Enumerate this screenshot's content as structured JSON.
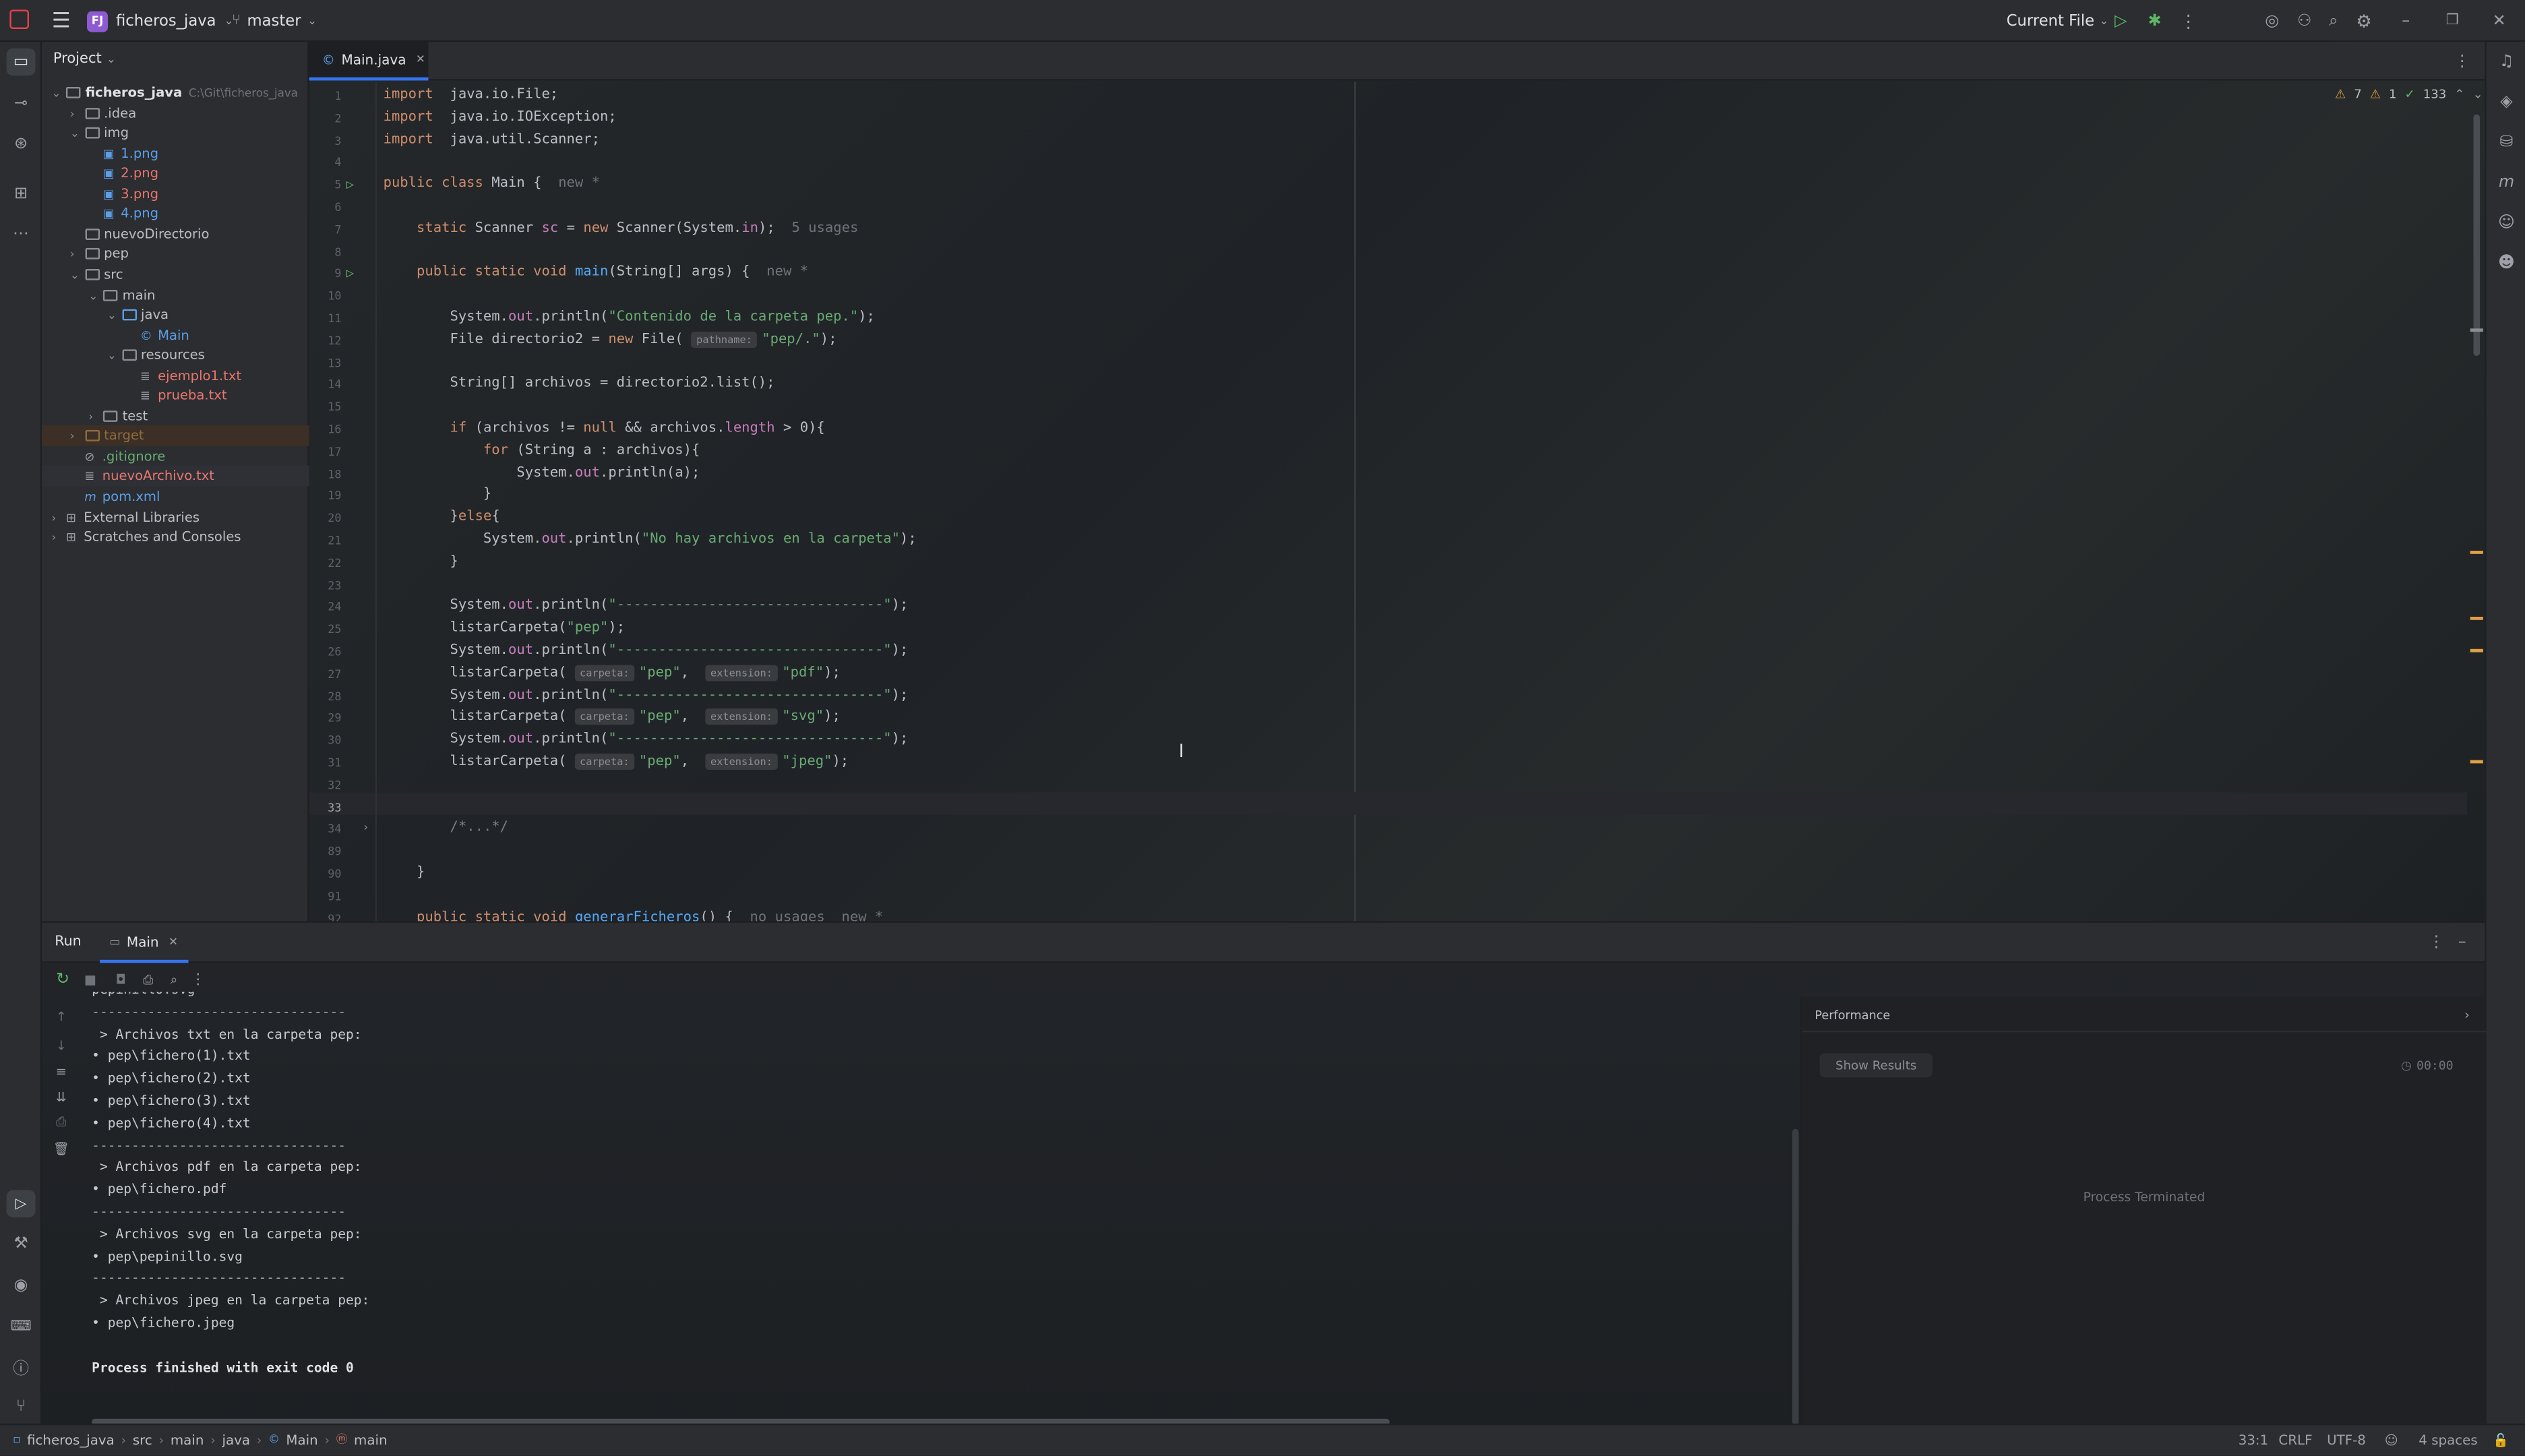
{
  "titlebar": {
    "project_badge": "FJ",
    "project_name": "ficheros_java",
    "branch": "master",
    "run_config": "Current File"
  },
  "project_panel": {
    "title": "Project",
    "tree": [
      {
        "label": "ficheros_java",
        "extra": "C:\\Git\\ficheros_java",
        "depth": 0,
        "chev": "v",
        "kind": "folder",
        "color": "#dfe1e5",
        "bold": true
      },
      {
        "label": ".idea",
        "depth": 1,
        "chev": ">",
        "kind": "folder",
        "color": "#bcbec4"
      },
      {
        "label": "img",
        "depth": 1,
        "chev": "v",
        "kind": "folder",
        "color": "#bcbec4"
      },
      {
        "label": "1.png",
        "depth": 2,
        "chev": "",
        "kind": "image",
        "color": "#5c9fe8"
      },
      {
        "label": "2.png",
        "depth": 2,
        "chev": "",
        "kind": "image",
        "color": "#e8766e"
      },
      {
        "label": "3.png",
        "depth": 2,
        "chev": "",
        "kind": "image",
        "color": "#e8766e"
      },
      {
        "label": "4.png",
        "depth": 2,
        "chev": "",
        "kind": "image",
        "color": "#5c9fe8"
      },
      {
        "label": "nuevoDirectorio",
        "depth": 1,
        "chev": "",
        "kind": "folder",
        "color": "#bcbec4"
      },
      {
        "label": "pep",
        "depth": 1,
        "chev": ">",
        "kind": "folder",
        "color": "#bcbec4"
      },
      {
        "label": "src",
        "depth": 1,
        "chev": "v",
        "kind": "folder",
        "color": "#bcbec4"
      },
      {
        "label": "main",
        "depth": 2,
        "chev": "v",
        "kind": "folder",
        "color": "#bcbec4"
      },
      {
        "label": "java",
        "depth": 3,
        "chev": "v",
        "kind": "folder-src",
        "color": "#bcbec4"
      },
      {
        "label": "Main",
        "depth": 4,
        "chev": "",
        "kind": "class",
        "color": "#5c9fe8"
      },
      {
        "label": "resources",
        "depth": 3,
        "chev": "v",
        "kind": "folder-res",
        "color": "#bcbec4"
      },
      {
        "label": "ejemplo1.txt",
        "depth": 4,
        "chev": "",
        "kind": "text",
        "color": "#e8766e"
      },
      {
        "label": "prueba.txt",
        "depth": 4,
        "chev": "",
        "kind": "text",
        "color": "#e8766e"
      },
      {
        "label": "test",
        "depth": 2,
        "chev": ">",
        "kind": "folder",
        "color": "#bcbec4"
      },
      {
        "label": "target",
        "depth": 1,
        "chev": ">",
        "kind": "folder",
        "color": "#8f6c3f",
        "excluded": true
      },
      {
        "label": ".gitignore",
        "depth": 1,
        "chev": "",
        "kind": "ignore",
        "color": "#6aab73"
      },
      {
        "label": "nuevoArchivo.txt",
        "depth": 1,
        "chev": "",
        "kind": "text",
        "color": "#e8766e",
        "selected": true
      },
      {
        "label": "pom.xml",
        "depth": 1,
        "chev": "",
        "kind": "maven",
        "color": "#5c9fe8"
      },
      {
        "label": "External Libraries",
        "depth": 0,
        "chev": ">",
        "kind": "lib",
        "color": "#bcbec4"
      },
      {
        "label": "Scratches and Consoles",
        "depth": 0,
        "chev": ">",
        "kind": "scratch",
        "color": "#bcbec4"
      }
    ]
  },
  "editor": {
    "tab_label": "Main.java",
    "inspections": {
      "warnings": "7",
      "weak": "1",
      "ok": "133"
    },
    "code_lines": [
      {
        "n": "1",
        "seg": [
          [
            "kw",
            "import"
          ],
          [
            "",
            "  java.io.File;"
          ]
        ]
      },
      {
        "n": "2",
        "seg": [
          [
            "kw",
            "import"
          ],
          [
            "",
            "  java.io.IOException;"
          ]
        ]
      },
      {
        "n": "3",
        "seg": [
          [
            "kw",
            "import"
          ],
          [
            "",
            "  java.util.Scanner;"
          ]
        ]
      },
      {
        "n": "4",
        "seg": []
      },
      {
        "n": "5",
        "seg": [
          [
            "kw",
            "public class"
          ],
          [
            "",
            " Main {  "
          ],
          [
            "dim",
            "new *"
          ]
        ],
        "run": true
      },
      {
        "n": "6",
        "seg": []
      },
      {
        "n": "7",
        "seg": [
          [
            "",
            "    "
          ],
          [
            "kw",
            "static"
          ],
          [
            "",
            " Scanner "
          ],
          [
            "fld",
            "sc"
          ],
          [
            "",
            " = "
          ],
          [
            "kw",
            "new"
          ],
          [
            "",
            " Scanner(System."
          ],
          [
            "fld",
            "in"
          ],
          [
            "",
            ");  "
          ],
          [
            "dim",
            "5 usages"
          ]
        ]
      },
      {
        "n": "8",
        "seg": []
      },
      {
        "n": "9",
        "seg": [
          [
            "",
            "    "
          ],
          [
            "kw",
            "public static void"
          ],
          [
            "",
            " "
          ],
          [
            "mth",
            "main"
          ],
          [
            "",
            "(String[] args) {  "
          ],
          [
            "dim",
            "new *"
          ]
        ],
        "run": true
      },
      {
        "n": "10",
        "seg": []
      },
      {
        "n": "11",
        "seg": [
          [
            "",
            "        System."
          ],
          [
            "fld",
            "out"
          ],
          [
            "",
            ".println("
          ],
          [
            "str",
            "\"Contenido de la carpeta pep.\""
          ],
          [
            "",
            ");"
          ]
        ]
      },
      {
        "n": "12",
        "seg": [
          [
            "",
            "        File directorio2 = "
          ],
          [
            "kw",
            "new"
          ],
          [
            "",
            " File( "
          ],
          [
            "hint",
            "pathname:"
          ],
          [
            "str",
            "\"pep/.\""
          ],
          [
            "",
            ");"
          ]
        ]
      },
      {
        "n": "13",
        "seg": []
      },
      {
        "n": "14",
        "seg": [
          [
            "",
            "        String[] archivos = directorio2.list();"
          ]
        ]
      },
      {
        "n": "15",
        "seg": []
      },
      {
        "n": "16",
        "seg": [
          [
            "",
            "        "
          ],
          [
            "kw",
            "if"
          ],
          [
            "",
            " (archivos != "
          ],
          [
            "kw",
            "null"
          ],
          [
            "",
            " && archivos."
          ],
          [
            "fld",
            "length"
          ],
          [
            "",
            " > 0){"
          ]
        ]
      },
      {
        "n": "17",
        "seg": [
          [
            "",
            "            "
          ],
          [
            "kw",
            "for"
          ],
          [
            "",
            " (String a : archivos){"
          ]
        ]
      },
      {
        "n": "18",
        "seg": [
          [
            "",
            "                System."
          ],
          [
            "fld",
            "out"
          ],
          [
            "",
            ".println(a);"
          ]
        ]
      },
      {
        "n": "19",
        "seg": [
          [
            "",
            "            }"
          ]
        ]
      },
      {
        "n": "20",
        "seg": [
          [
            "",
            "        }"
          ],
          [
            "kw",
            "else"
          ],
          [
            "",
            "{"
          ]
        ]
      },
      {
        "n": "21",
        "seg": [
          [
            "",
            "            System."
          ],
          [
            "fld",
            "out"
          ],
          [
            "",
            ".println("
          ],
          [
            "str",
            "\"No hay archivos en la carpeta\""
          ],
          [
            "",
            ");"
          ]
        ]
      },
      {
        "n": "22",
        "seg": [
          [
            "",
            "        }"
          ]
        ]
      },
      {
        "n": "23",
        "seg": []
      },
      {
        "n": "24",
        "seg": [
          [
            "",
            "        System."
          ],
          [
            "fld",
            "out"
          ],
          [
            "",
            ".println("
          ],
          [
            "str",
            "\"--------------------------------\""
          ],
          [
            "",
            ");"
          ]
        ]
      },
      {
        "n": "25",
        "seg": [
          [
            "",
            "        listarCarpeta("
          ],
          [
            "str",
            "\"pep\""
          ],
          [
            "",
            ");"
          ]
        ]
      },
      {
        "n": "26",
        "seg": [
          [
            "",
            "        System."
          ],
          [
            "fld",
            "out"
          ],
          [
            "",
            ".println("
          ],
          [
            "str",
            "\"--------------------------------\""
          ],
          [
            "",
            ");"
          ]
        ]
      },
      {
        "n": "27",
        "seg": [
          [
            "",
            "        listarCarpeta( "
          ],
          [
            "hint",
            "carpeta:"
          ],
          [
            "str",
            "\"pep\""
          ],
          [
            "",
            ",  "
          ],
          [
            "hint",
            "extension:"
          ],
          [
            "str",
            "\"pdf\""
          ],
          [
            "",
            ");"
          ]
        ]
      },
      {
        "n": "28",
        "seg": [
          [
            "",
            "        System."
          ],
          [
            "fld",
            "out"
          ],
          [
            "",
            ".println("
          ],
          [
            "str",
            "\"--------------------------------\""
          ],
          [
            "",
            ");"
          ]
        ]
      },
      {
        "n": "29",
        "seg": [
          [
            "",
            "        listarCarpeta( "
          ],
          [
            "hint",
            "carpeta:"
          ],
          [
            "str",
            "\"pep\""
          ],
          [
            "",
            ",  "
          ],
          [
            "hint",
            "extension:"
          ],
          [
            "str",
            "\"svg\""
          ],
          [
            "",
            ");"
          ]
        ]
      },
      {
        "n": "30",
        "seg": [
          [
            "",
            "        System."
          ],
          [
            "fld",
            "out"
          ],
          [
            "",
            ".println("
          ],
          [
            "str",
            "\"--------------------------------\""
          ],
          [
            "",
            ");"
          ]
        ]
      },
      {
        "n": "31",
        "seg": [
          [
            "",
            "        listarCarpeta( "
          ],
          [
            "hint",
            "carpeta:"
          ],
          [
            "str",
            "\"pep\""
          ],
          [
            "",
            ",  "
          ],
          [
            "hint",
            "extension:"
          ],
          [
            "str",
            "\"jpeg\""
          ],
          [
            "",
            ");"
          ]
        ]
      },
      {
        "n": "32",
        "seg": []
      },
      {
        "n": "33",
        "seg": [],
        "current": true
      },
      {
        "n": "34",
        "seg": [
          [
            "",
            "        "
          ],
          [
            "cm",
            "/*...*/"
          ]
        ],
        "fold": true
      },
      {
        "n": "89",
        "seg": []
      },
      {
        "n": "90",
        "seg": [
          [
            "",
            "    }"
          ]
        ]
      },
      {
        "n": "91",
        "seg": []
      },
      {
        "n": "92",
        "seg": [
          [
            "",
            "    "
          ],
          [
            "kw",
            "public static void"
          ],
          [
            "",
            " "
          ],
          [
            "mth",
            "generarFicheros"
          ],
          [
            "",
            "() {  "
          ],
          [
            "dim",
            "no usages  new *"
          ]
        ]
      }
    ]
  },
  "run_panel": {
    "tab_run": "Run",
    "tab_main": "Main",
    "output": [
      "pepinillo.svg",
      "--------------------------------",
      " > Archivos txt en la carpeta pep:",
      "• pep\\fichero(1).txt",
      "• pep\\fichero(2).txt",
      "• pep\\fichero(3).txt",
      "• pep\\fichero(4).txt",
      "--------------------------------",
      " > Archivos pdf en la carpeta pep:",
      "• pep\\fichero.pdf",
      "--------------------------------",
      " > Archivos svg en la carpeta pep:",
      "• pep\\pepinillo.svg",
      "--------------------------------",
      " > Archivos jpeg en la carpeta pep:",
      "• pep\\fichero.jpeg",
      "",
      "Process finished with exit code 0"
    ],
    "performance_title": "Performance",
    "show_results": "Show Results",
    "timer": "00:00",
    "process_status": "Process Terminated"
  },
  "statusbar": {
    "breadcrumb": [
      "ficheros_java",
      "src",
      "main",
      "java",
      "Main",
      "main"
    ],
    "position": "33:1",
    "line_sep": "CRLF",
    "encoding": "UTF-8",
    "indent": "4 spaces"
  }
}
